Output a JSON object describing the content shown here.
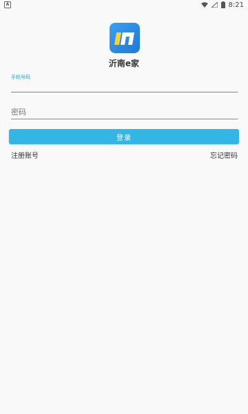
{
  "status_bar": {
    "notification_icon": "A",
    "time": "8:21",
    "icons": [
      "wifi-icon",
      "signal-icon",
      "battery-icon"
    ]
  },
  "app": {
    "name": "沂南e家",
    "logo_color": "#2f8fe6",
    "logo_accent": "#f5d23b"
  },
  "form": {
    "phone_label": "手机号码",
    "phone_value": "",
    "password_placeholder": "密码",
    "login_label": "登录",
    "accent_color": "#33b6e6"
  },
  "links": {
    "register": "注册账号",
    "forgot_password": "忘记密码"
  }
}
